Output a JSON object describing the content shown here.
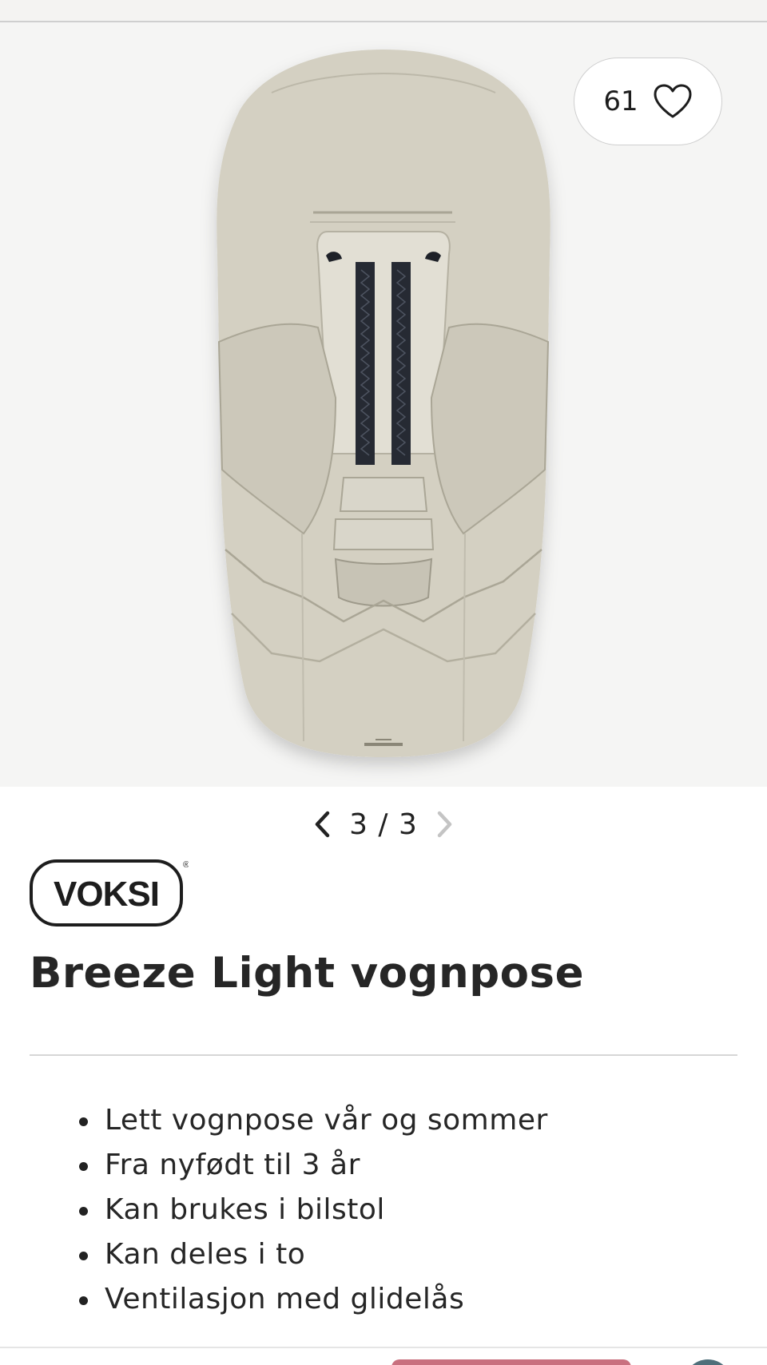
{
  "favorite": {
    "count": "61",
    "icon": "heart-outline-icon"
  },
  "gallery": {
    "current": "3",
    "separator": "/",
    "total": "3",
    "prev_icon": "chevron-left-icon",
    "next_icon": "chevron-right-icon"
  },
  "brand": {
    "name": "VOKSI",
    "registered": "®"
  },
  "product": {
    "title": "Breeze Light vognpose",
    "features": [
      "Lett vognpose vår og sommer",
      "Fra nyfødt til 3 år",
      "Kan brukes i bilstol",
      "Kan deles i to",
      "Ventilasjon med glidelås"
    ]
  },
  "colors": {
    "fabric": "#cfcbbd",
    "strap": "#262a33",
    "bottom_pill": "#c9707f",
    "bottom_circle": "#4f6f7a"
  }
}
